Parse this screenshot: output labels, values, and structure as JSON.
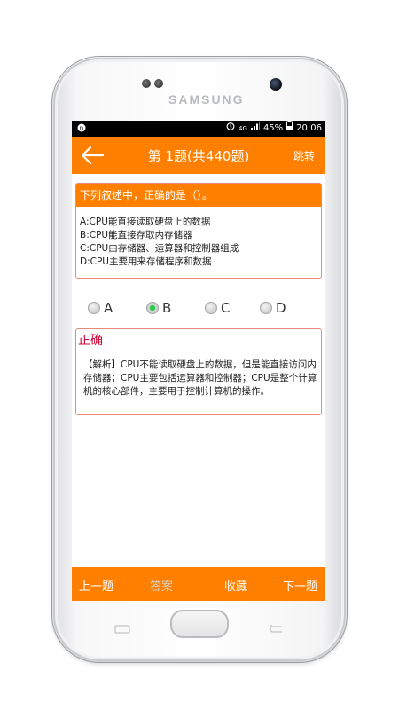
{
  "device": {
    "brand": "SAMSUNG"
  },
  "status_bar": {
    "left_icon": "app-notification-icon",
    "network": "4G",
    "battery": "45%",
    "time": "20:06"
  },
  "header": {
    "title": "第 1题(共440题)",
    "action_label": "跳转"
  },
  "question": {
    "title": "下列叙述中，正确的是（）。",
    "options": [
      "A:CPU能直接读取硬盘上的数据",
      "B:CPU能直接存取内存储器",
      "C:CPU由存储器、运算器和控制器组成",
      "D:CPU主要用来存储程序和数据"
    ]
  },
  "choices": {
    "labels": [
      "A",
      "B",
      "C",
      "D"
    ],
    "selected": "B"
  },
  "answer": {
    "status": "正确",
    "explanation": "【解析】CPU不能读取硬盘上的数据，但是能直接访问内存储器；CPU主要包括运算器和控制器；CPU是整个计算机的核心部件，主要用于控制计算机的操作。"
  },
  "bottom_bar": {
    "prev_label": "上一题",
    "answer_label": "答案",
    "favorite_label": "收藏",
    "next_label": "下一题"
  },
  "colors": {
    "accent": "#ff7f00",
    "correct": "#cc0033",
    "selected_radio": "#2ec84a"
  }
}
